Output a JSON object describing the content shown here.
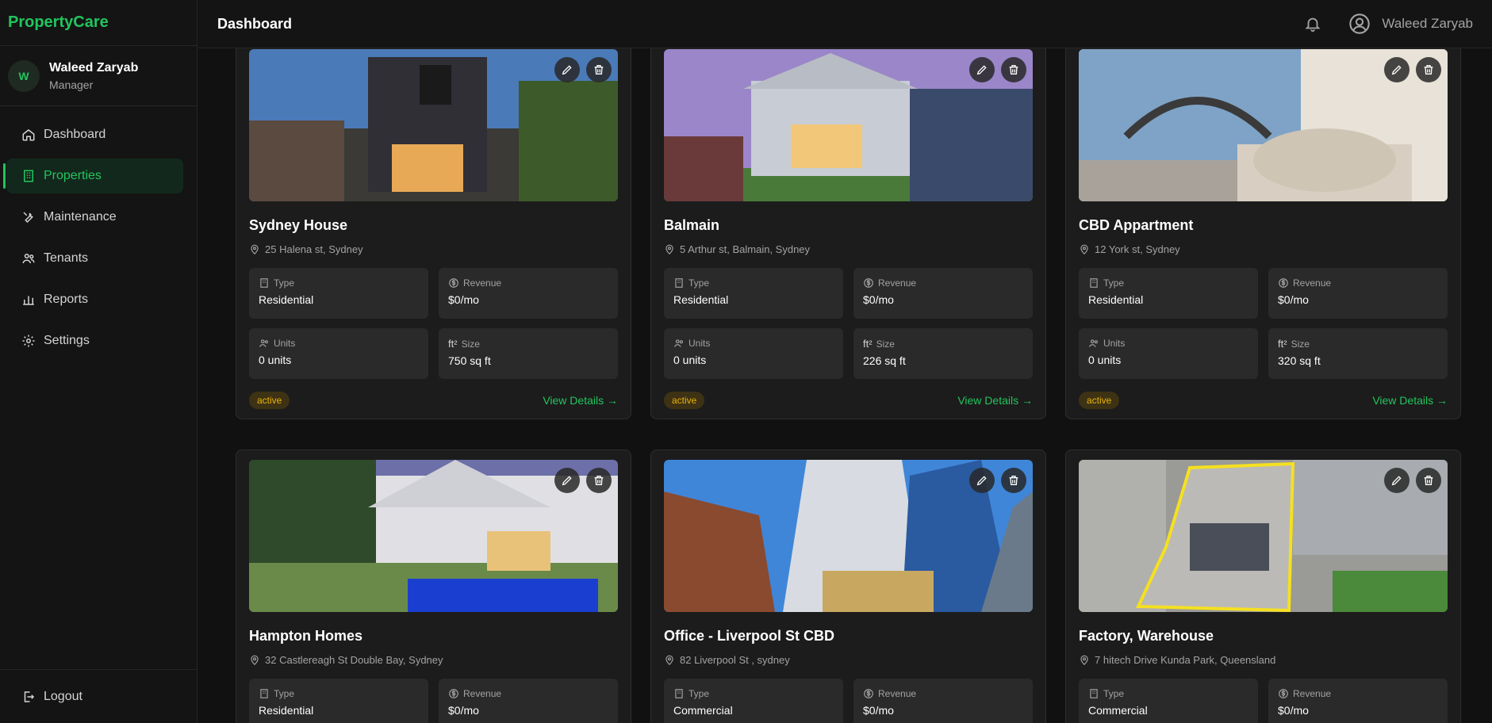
{
  "brand": "PropertyCare",
  "user": {
    "initial": "W",
    "name": "Waleed Zaryab",
    "role": "Manager"
  },
  "nav": [
    {
      "label": "Dashboard",
      "icon": "home-icon"
    },
    {
      "label": "Properties",
      "icon": "building-icon",
      "active": true
    },
    {
      "label": "Maintenance",
      "icon": "wrench-icon"
    },
    {
      "label": "Tenants",
      "icon": "users-icon"
    },
    {
      "label": "Reports",
      "icon": "bar-chart-icon"
    },
    {
      "label": "Settings",
      "icon": "gear-icon"
    }
  ],
  "logout": "Logout",
  "topbar": {
    "title": "Dashboard",
    "username": "Waleed Zaryab"
  },
  "labels": {
    "type": "Type",
    "revenue": "Revenue",
    "units": "Units",
    "size": "Size",
    "ft": "ft²",
    "view": "View Details →"
  },
  "colors": {
    "accent": "#22c55e",
    "badge": "#eab308",
    "background": "#111111"
  },
  "properties": [
    {
      "name": "Sydney House",
      "address": "25 Halena st, Sydney",
      "type": "Residential",
      "revenue": "$0/mo",
      "units": "0 units",
      "size": "750 sq ft",
      "status": "active"
    },
    {
      "name": "Balmain",
      "address": "5 Arthur st, Balmain, Sydney",
      "type": "Residential",
      "revenue": "$0/mo",
      "units": "0 units",
      "size": "226 sq ft",
      "status": "active"
    },
    {
      "name": "CBD Appartment",
      "address": "12 York st, Sydney",
      "type": "Residential",
      "revenue": "$0/mo",
      "units": "0 units",
      "size": "320 sq ft",
      "status": "active"
    },
    {
      "name": "Hampton Homes",
      "address": "32 Castlereagh St Double Bay, Sydney",
      "type": "Residential",
      "revenue": "$0/mo",
      "units": "",
      "size": "",
      "status": ""
    },
    {
      "name": "Office - Liverpool St CBD",
      "address": "82 Liverpool St , sydney",
      "type": "Commercial",
      "revenue": "$0/mo",
      "units": "",
      "size": "",
      "status": ""
    },
    {
      "name": "Factory, Warehouse",
      "address": "7 hitech Drive Kunda Park, Queensland",
      "type": "Commercial",
      "revenue": "$0/mo",
      "units": "",
      "size": "",
      "status": ""
    }
  ]
}
